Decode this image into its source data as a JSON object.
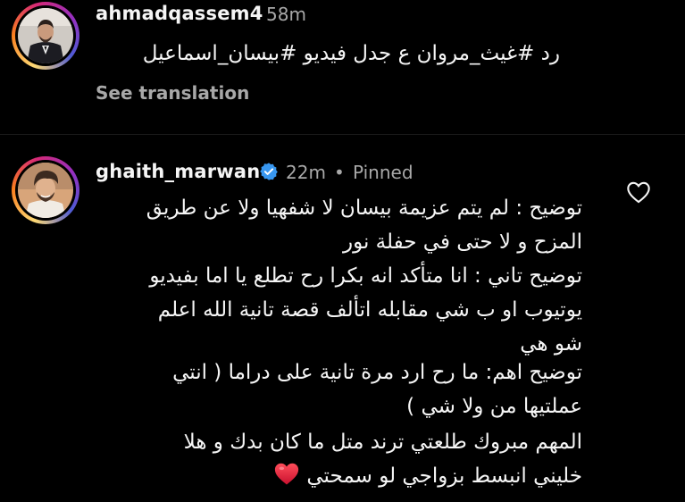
{
  "comments": [
    {
      "username": "ahmadqassem4",
      "time": "58m",
      "text": "رد #غيث_مروان ع جدل فيديو #بيسان_اسماعيل",
      "translate_label": "See translation"
    },
    {
      "username": "ghaith_marwan",
      "verified": true,
      "time": "22m",
      "separator": "•",
      "pinned_label": "Pinned",
      "paragraphs": [
        [
          "توضيح : لم يتم عزيمة بيسان لا شفهيا ولا عن طريق",
          "المزح و لا حتى في حفلة نور"
        ],
        [
          "توضيح تاني : انا متأكد انه بكرا رح تطلع يا اما بفيديو",
          "يوتيوب او ب شي مقابله اتألف قصة تانية الله اعلم",
          "شو هي"
        ],
        [
          "توضيح اهم: ما رح ارد مرة تانية على دراما ( انتي",
          "عملتيها من ولا شي )"
        ],
        [
          "المهم مبروك طلعتي ترند متل ما كان بدك و هلا",
          "خليني انبسط بزواجي لو سمحتي"
        ]
      ],
      "emoji": "❤️",
      "like_icon": "heart-outline-icon"
    }
  ],
  "colors": {
    "background": "#000000",
    "text": "#f5f5f5",
    "secondary": "#a8a8a8",
    "verified": "#3897f0"
  }
}
